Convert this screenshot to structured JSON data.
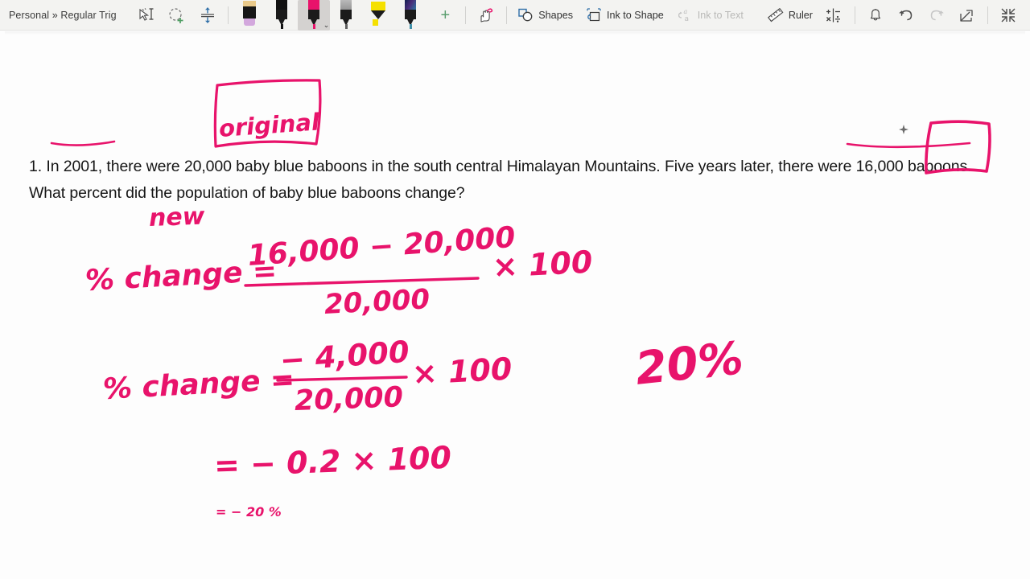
{
  "window": {
    "breadcrumb": "Personal » Regular Trig",
    "notebook": "Personal",
    "section": "Regular Trig"
  },
  "colors": {
    "ink_pink": "#e8136b",
    "toolbar_bg": "#f3f3f1",
    "selected_pen_bg": "#d4d2d0",
    "canvas_bg": "#fdfdfd",
    "text": "#161616",
    "disabled_text": "#b9b9b7",
    "accent_green": "#5a9e6f",
    "accent_blue": "#2f6fa8"
  },
  "toolbar": {
    "select_tool": {
      "name": "lasso-select",
      "label": "Lasso Select"
    },
    "add_selection_tool": {
      "name": "add-selection",
      "label": "Select and Add"
    },
    "insert_space_tool": {
      "name": "insert-space",
      "label": "Insert Space"
    },
    "pens": [
      {
        "name": "eraser",
        "label": "Eraser",
        "cap": "#e9c98a",
        "tip": "#d3a8dd",
        "selected": false,
        "type": "eraser"
      },
      {
        "name": "pen-black",
        "label": "Black Pen",
        "cap": "#111111",
        "tip": "#111111",
        "selected": false,
        "type": "pen"
      },
      {
        "name": "pen-pink",
        "label": "Pink Pen",
        "cap": "#e8136b",
        "tip": "#e8136b",
        "selected": true,
        "type": "pen"
      },
      {
        "name": "pencil-gray",
        "label": "Pencil",
        "cap": "#9b9b9b",
        "tip": "#6f6f6f",
        "selected": false,
        "type": "pencil"
      },
      {
        "name": "highlighter-yellow",
        "label": "Yellow Highlighter",
        "cap": "#f5e000",
        "tip": "#f5e000",
        "selected": false,
        "type": "highlighter"
      },
      {
        "name": "pen-galaxy",
        "label": "Galaxy Pen",
        "cap": "#2b2f6b",
        "tip": "#3f8fa8",
        "selected": false,
        "type": "pen"
      }
    ],
    "add_pen_label": "+",
    "touch_draw_label": "Draw with Touch",
    "shapes_label": "Shapes",
    "ink_to_shape_label": "Ink to Shape",
    "ink_to_text_label": "Ink to Text",
    "ink_to_text_disabled": true,
    "ruler_label": "Ruler",
    "math_label": "Math",
    "notify_label": "Notifications",
    "undo_label": "Undo",
    "redo_label": "Redo",
    "redo_disabled": true,
    "share_label": "Share",
    "collapse_label": "Collapse Ribbon"
  },
  "page": {
    "question_number": "1.",
    "question_text": "1. In 2001, there were 20,000 baby blue baboons in the south central Himalayan Mountains. Five years later, there were 16,000 baboons. What percent did the population of baby blue baboons change?",
    "annotations": {
      "original_label": "original",
      "new_label": "new",
      "answer_highlight": "20%"
    },
    "work": [
      {
        "id": "line1-lhs",
        "text": "% change ="
      },
      {
        "id": "line1-numer",
        "text": "16,000 − 20,000"
      },
      {
        "id": "line1-denom",
        "text": "20,000"
      },
      {
        "id": "line1-mult",
        "text": "× 100"
      },
      {
        "id": "line2-lhs",
        "text": "% change ="
      },
      {
        "id": "line2-numer",
        "text": "− 4,000"
      },
      {
        "id": "line2-denom",
        "text": "20,000"
      },
      {
        "id": "line2-mult",
        "text": "× 100"
      },
      {
        "id": "line3",
        "text": "= − 0.2 × 100"
      },
      {
        "id": "line4",
        "text": "= − 20 %"
      }
    ]
  }
}
